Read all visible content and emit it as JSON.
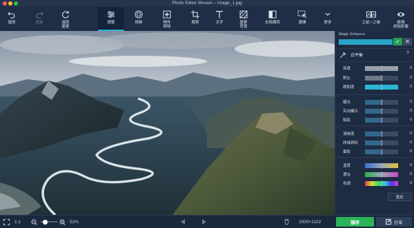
{
  "window": {
    "title": "Photo Editor Movavi – Image_1.jpg"
  },
  "toolbar": {
    "undo": "復原",
    "redo": "重做",
    "reset_changes": "還原\n變更",
    "adjust": "調整",
    "retouch": "修飾",
    "remove_object": "物件\n移除",
    "crop": "裁剪",
    "text": "文字",
    "change_background": "變更\n背景",
    "noise_removal": "去除雜訊",
    "select": "選擇",
    "more": "更多",
    "before_after": "之前 / 之後",
    "original": "檢視\n原始影像"
  },
  "panel": {
    "magic_enhance": "Magic Enhance",
    "white_balance": "白平衡",
    "help": "?",
    "sliders": [
      {
        "label": "亮度",
        "value": "0",
        "fill": 1.0,
        "color": "#9aa1ab"
      },
      {
        "label": "對比",
        "value": "0",
        "fill": 0.5,
        "color": "#9aa1ab"
      },
      {
        "label": "飽和度",
        "value": "0",
        "fill": 1.0,
        "color": "#2ab5d6"
      },
      {
        "label": "曝光",
        "value": "0",
        "fill": 0.5,
        "color": "#2e7fb0"
      },
      {
        "label": "突出顯示",
        "value": "0",
        "fill": 0.5,
        "color": "#2e7fb0"
      },
      {
        "label": "陰影",
        "value": "0",
        "fill": 0.5,
        "color": "#2e7fb0"
      },
      {
        "label": "清晰度",
        "value": "0",
        "fill": 0.5,
        "color": "#2e7fb0"
      },
      {
        "label": "詳細資料",
        "value": "0",
        "fill": 0.5,
        "color": "#2e7fb0"
      },
      {
        "label": "暈影",
        "value": "0",
        "fill": 0.5,
        "color": "#2e7fb0"
      },
      {
        "label": "溫度",
        "value": "0",
        "fill": 1.0,
        "color": "gradient-temp"
      },
      {
        "label": "濃淡",
        "value": "0",
        "fill": 1.0,
        "color": "gradient-tint"
      },
      {
        "label": "色調",
        "value": "0",
        "fill": 1.0,
        "color": "gradient-hue"
      }
    ],
    "reset": "重設"
  },
  "bottombar": {
    "zoom_1to1": "1:1",
    "zoom_percent": "52%",
    "dimensions": "2000×1102",
    "save": "儲存",
    "share": "分享"
  },
  "colors": {
    "accent": "#2cb4d8",
    "save": "#2bb35a",
    "panel": "#1d2c43"
  }
}
